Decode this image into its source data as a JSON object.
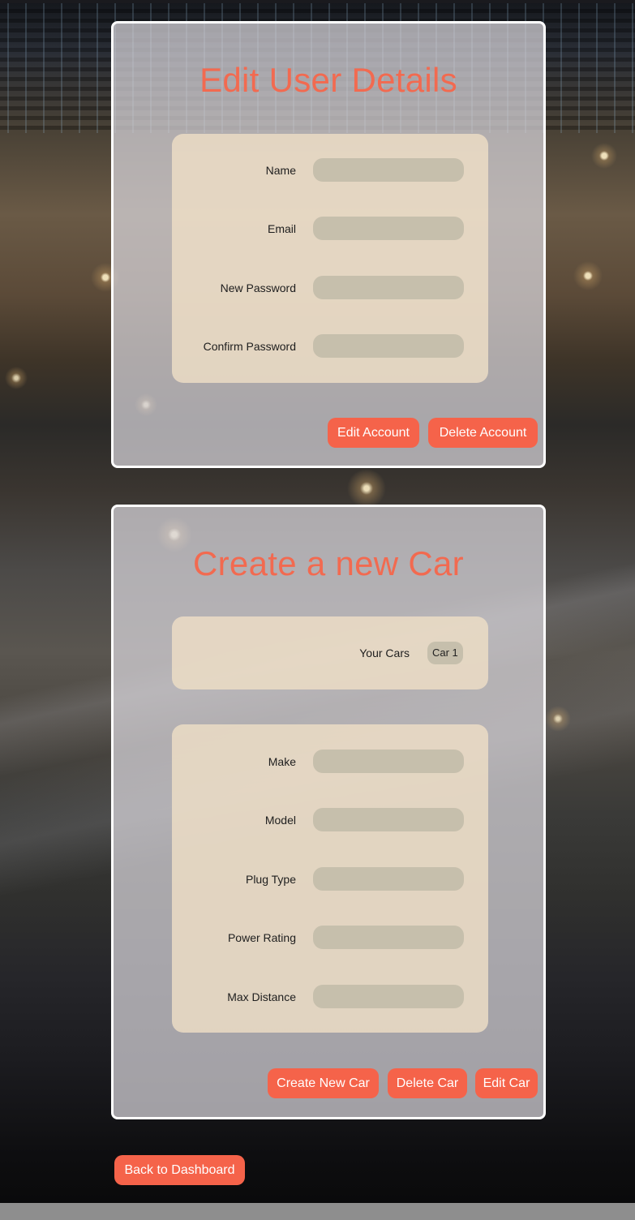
{
  "user_details": {
    "title": "Edit User Details",
    "fields": [
      {
        "label": "Name",
        "value": "",
        "placeholder": ""
      },
      {
        "label": "Email",
        "value": "",
        "placeholder": ""
      },
      {
        "label": "New Password",
        "value": "",
        "placeholder": ""
      },
      {
        "label": "Confirm Password",
        "value": "",
        "placeholder": ""
      }
    ],
    "buttons": {
      "edit": "Edit Account",
      "delete": "Delete Account"
    }
  },
  "car": {
    "title": "Create a new Car",
    "your_cars_label": "Your Cars",
    "cars": [
      "Car 1"
    ],
    "fields": [
      {
        "label": "Make",
        "value": "",
        "placeholder": ""
      },
      {
        "label": "Model",
        "value": "",
        "placeholder": ""
      },
      {
        "label": "Plug Type",
        "value": "",
        "placeholder": ""
      },
      {
        "label": "Power Rating",
        "value": "",
        "placeholder": ""
      },
      {
        "label": "Max Distance",
        "value": "",
        "placeholder": ""
      }
    ],
    "buttons": {
      "create": "Create New Car",
      "delete": "Delete Car",
      "edit": "Edit Car"
    }
  },
  "back_button": "Back to Dashboard",
  "colors": {
    "accent": "#f5634a",
    "title": "#f26a50",
    "field": "#c6bfac",
    "panel": "#eedec6",
    "card_border": "#ffffff"
  }
}
